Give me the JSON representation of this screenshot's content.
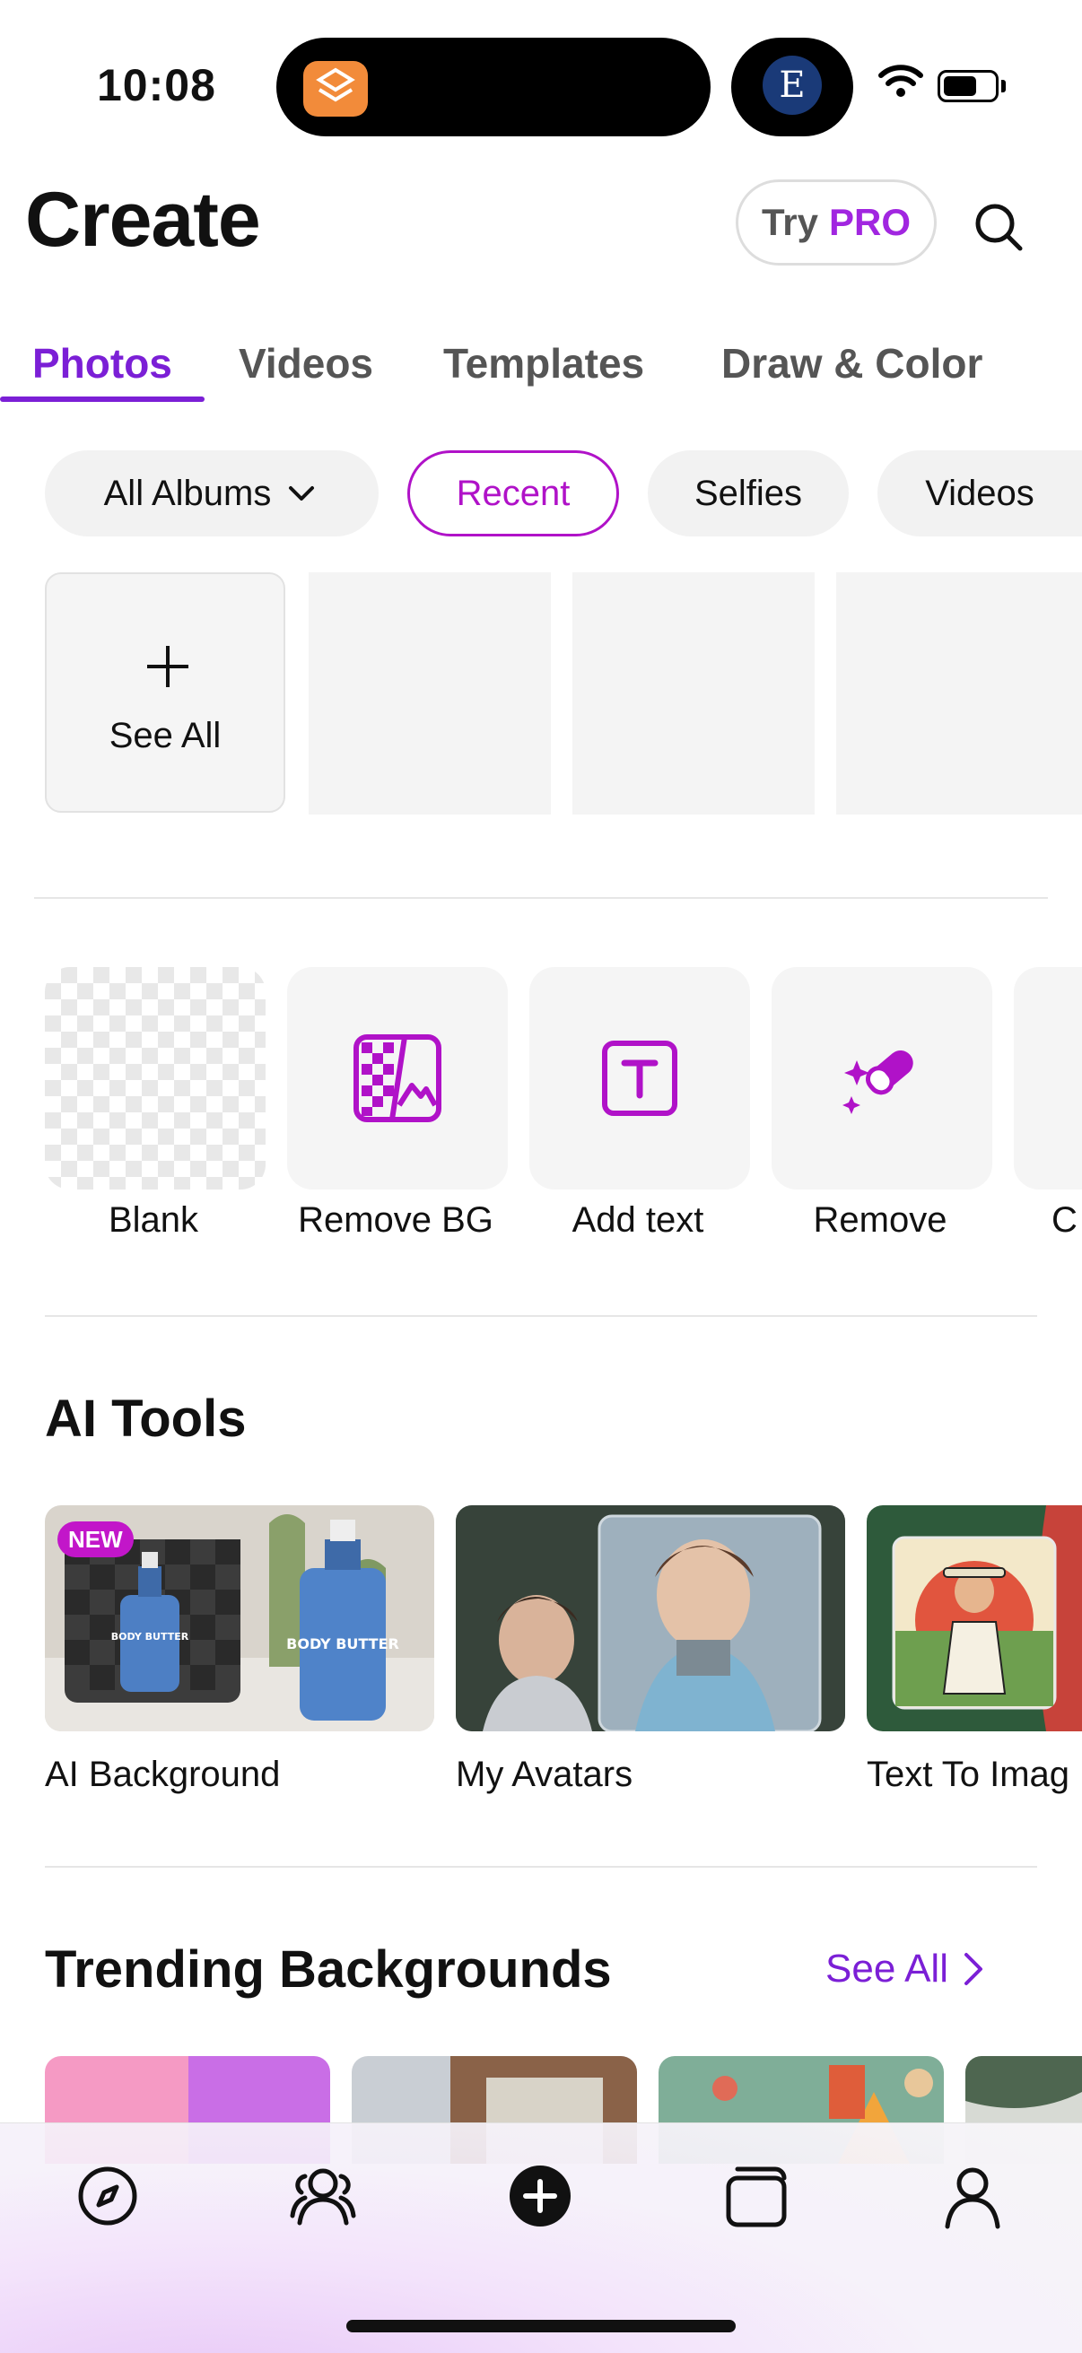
{
  "status_bar": {
    "time": "10:08",
    "album_letter": "E"
  },
  "header": {
    "title": "Create",
    "try": "Try",
    "pro": "PRO"
  },
  "tabs": [
    {
      "label": "Photos",
      "active": true
    },
    {
      "label": "Videos"
    },
    {
      "label": "Templates"
    },
    {
      "label": "Draw & Color"
    }
  ],
  "chips": [
    {
      "label": "All Albums",
      "dropdown": true
    },
    {
      "label": "Recent",
      "selected": true
    },
    {
      "label": "Selfies"
    },
    {
      "label": "Videos"
    }
  ],
  "recents": {
    "see_all": "See All"
  },
  "quick_tools": [
    {
      "label": "Blank"
    },
    {
      "label": "Remove BG"
    },
    {
      "label": "Add text"
    },
    {
      "label": "Remove"
    },
    {
      "label": "C"
    }
  ],
  "ai_tools": {
    "title": "AI Tools",
    "new_badge": "NEW",
    "product_text": "BODY BUTTER",
    "items": [
      {
        "label": "AI Background"
      },
      {
        "label": "My Avatars"
      },
      {
        "label": "Text To Imag"
      }
    ]
  },
  "trending": {
    "title": "Trending Backgrounds",
    "see_all": "See All"
  },
  "colors": {
    "accent": "#7b1fd6",
    "magenta": "#b012c8"
  },
  "bottom_nav": [
    "compass-icon",
    "people-icon",
    "create-icon",
    "projects-icon",
    "profile-icon"
  ]
}
